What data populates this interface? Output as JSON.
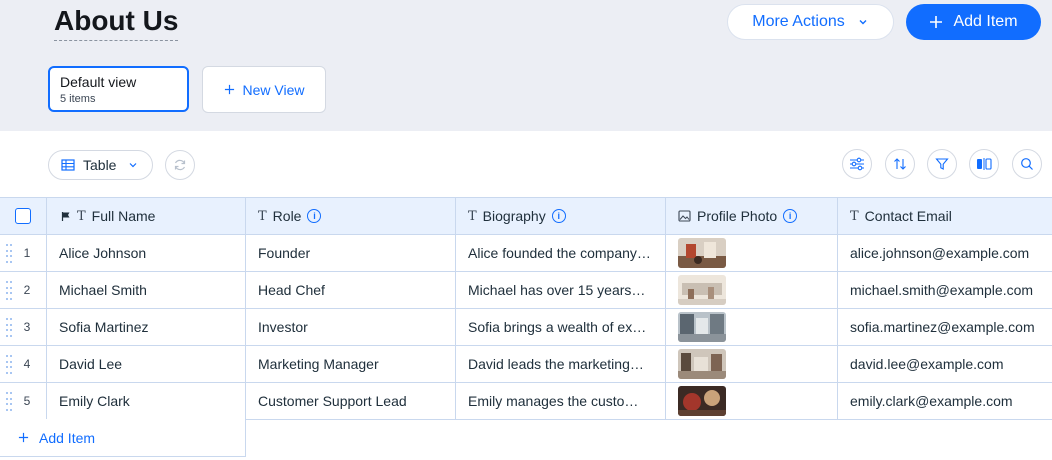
{
  "header": {
    "title": "About Us",
    "more_actions": "More Actions",
    "add_item": "Add Item"
  },
  "views": {
    "default": {
      "title": "Default view",
      "subtitle": "5 items"
    },
    "new_view": "New View"
  },
  "toolbar": {
    "table_label": "Table"
  },
  "columns": {
    "full_name": "Full Name",
    "role": "Role",
    "biography": "Biography",
    "profile_photo": "Profile Photo",
    "contact_email": "Contact Email"
  },
  "rows": [
    {
      "num": "1",
      "name": "Alice Johnson",
      "role": "Founder",
      "bio": "Alice founded the company",
      "email": "alice.johnson@example.com"
    },
    {
      "num": "2",
      "name": "Michael Smith",
      "role": "Head Chef",
      "bio": "Michael has over 15 years",
      "email": "michael.smith@example.com"
    },
    {
      "num": "3",
      "name": "Sofia Martinez",
      "role": "Investor",
      "bio": "Sofia brings a wealth of ex",
      "email": "sofia.martinez@example.com"
    },
    {
      "num": "4",
      "name": "David Lee",
      "role": "Marketing Manager",
      "bio": "David leads the marketing",
      "email": "david.lee@example.com"
    },
    {
      "num": "5",
      "name": "Emily Clark",
      "role": "Customer Support Lead",
      "bio": "Emily manages the custo",
      "email": "emily.clark@example.com"
    }
  ],
  "footer": {
    "add_item": "Add Item"
  },
  "colors": {
    "accent": "#116dff",
    "header_bg": "#e8f1fe",
    "page_bg": "#eceef4"
  }
}
